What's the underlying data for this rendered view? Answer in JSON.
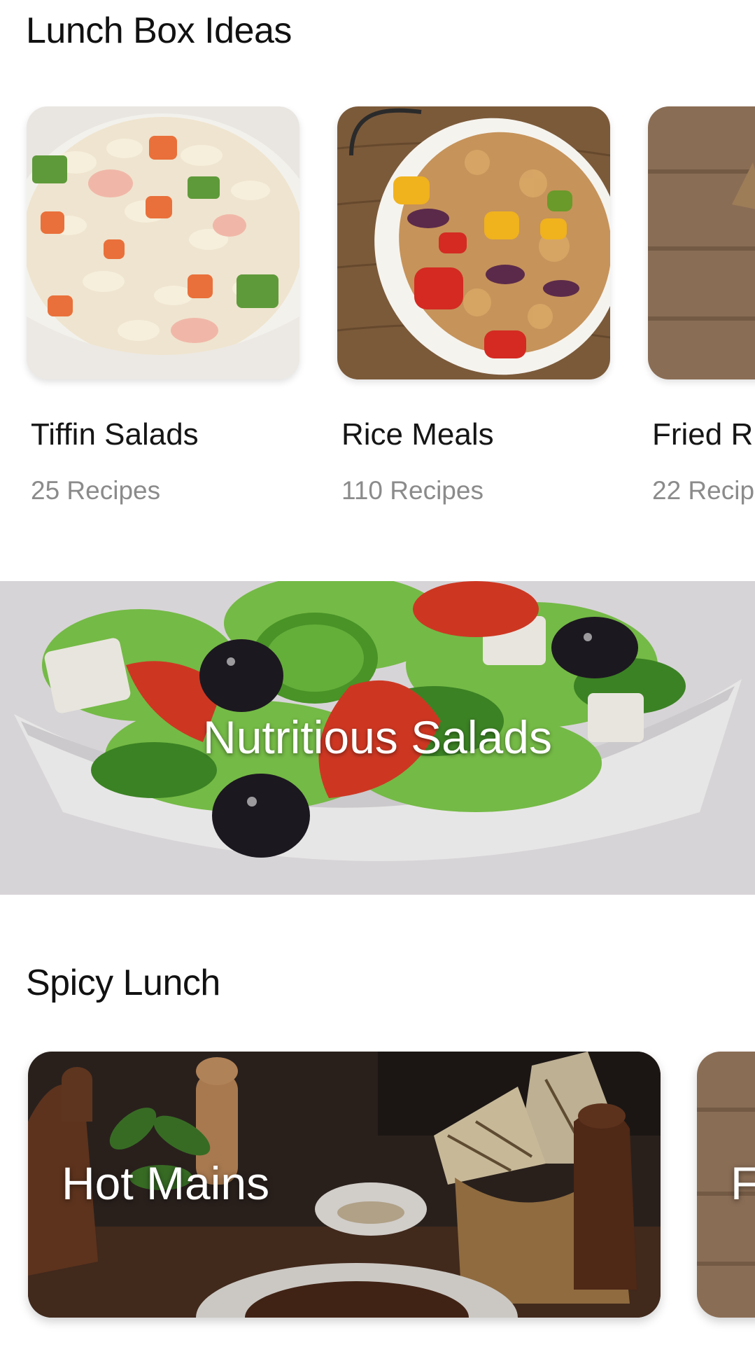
{
  "sections": {
    "lunch_box": {
      "title": "Lunch Box Ideas",
      "cards": [
        {
          "title": "Tiffin Salads",
          "count": "25 Recipes",
          "image": "pasta-salad-bowl"
        },
        {
          "title": "Rice Meals",
          "count": "110 Recipes",
          "image": "rice-vegetable-bowl"
        },
        {
          "title": "Fried R",
          "count": "22 Recip",
          "image": "wooden-table"
        }
      ]
    },
    "banner": {
      "label": "Nutritious Salads",
      "image": "greek-salad-bowl"
    },
    "spicy": {
      "title": "Spicy Lunch",
      "cards": [
        {
          "label": "Hot Mains",
          "image": "hot-mains-table"
        },
        {
          "label": "F",
          "image": "wooden-table"
        }
      ]
    }
  },
  "colors": {
    "background": "#ffffff",
    "title_text": "#111111",
    "subtitle_text": "#8b8b8b",
    "overlay_text": "#ffffff"
  }
}
